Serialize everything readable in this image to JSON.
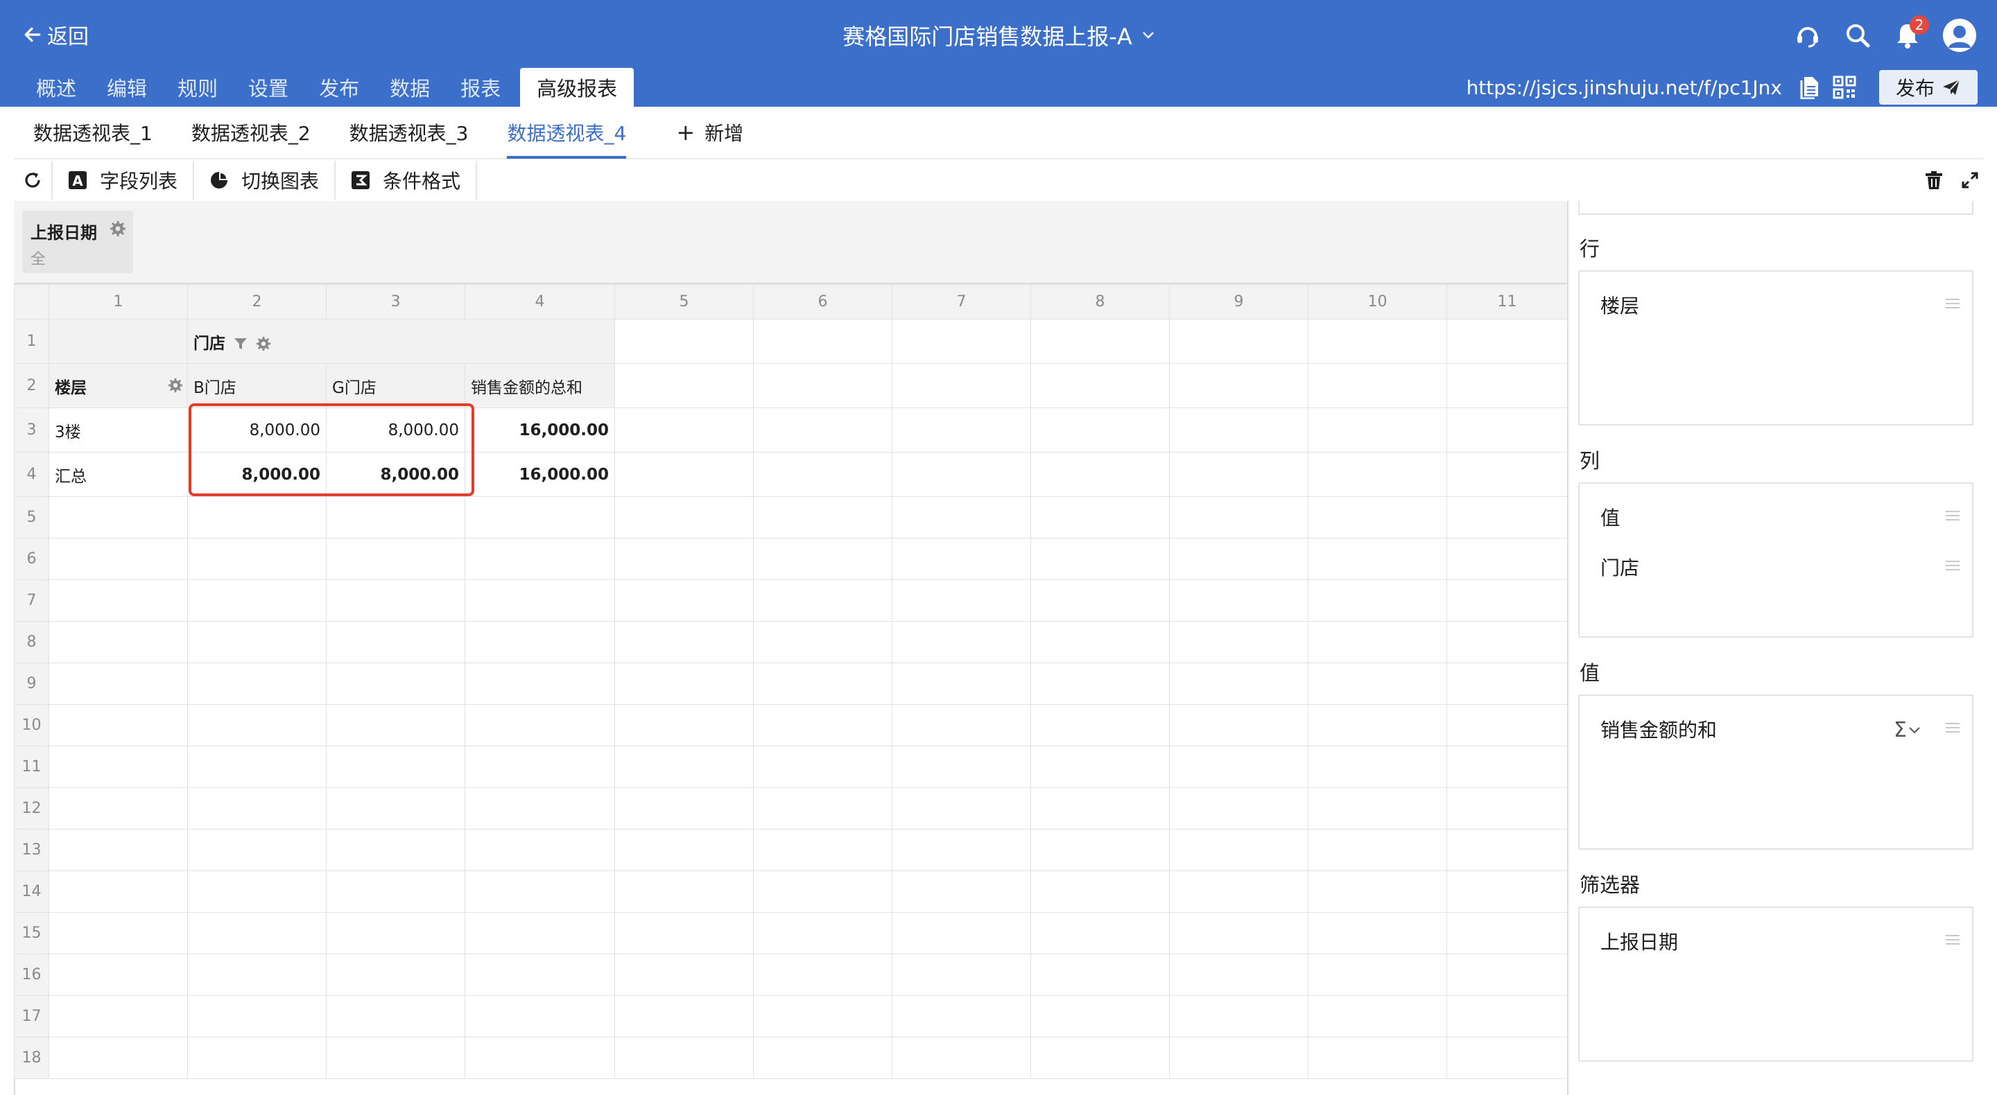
{
  "header": {
    "back_label": "返回",
    "form_title": "赛格国际门店销售数据上报-A",
    "notification_count": "2",
    "url": "https://jsjcs.jinshuju.net/f/pc1Jnx",
    "publish_label": "发布",
    "nav_tabs": [
      "概述",
      "编辑",
      "规则",
      "设置",
      "发布",
      "数据",
      "报表",
      "高级报表"
    ],
    "active_nav": "高级报表",
    "brand_color": "#3b6fc9"
  },
  "sheet_tabs": [
    "数据透视表_1",
    "数据透视表_2",
    "数据透视表_3",
    "数据透视表_4"
  ],
  "active_sheet": "数据透视表_4",
  "add_tab_label": "新增",
  "toolbar": {
    "field_list": "字段列表",
    "switch_chart": "切换图表",
    "conditional_format": "条件格式"
  },
  "filter": {
    "title": "上报日期",
    "value": "全"
  },
  "grid": {
    "columns": [
      "1",
      "2",
      "3",
      "4",
      "5",
      "6",
      "7",
      "8",
      "9",
      "10",
      "11"
    ],
    "row_numbers": [
      "1",
      "2",
      "3",
      "4",
      "5",
      "6",
      "7",
      "8",
      "9",
      "10",
      "11",
      "12",
      "13",
      "14",
      "15",
      "16",
      "17",
      "18"
    ],
    "column_field": "门店",
    "row_field": "楼层",
    "headers": [
      "B门店",
      "G门店",
      "销售金额的总和"
    ],
    "rows": [
      {
        "label": "3楼",
        "values": [
          "8,000.00",
          "8,000.00",
          "16,000.00"
        ]
      },
      {
        "label": "汇总",
        "values": [
          "8,000.00",
          "8,000.00",
          "16,000.00"
        ]
      }
    ]
  },
  "panel": {
    "rows_label": "行",
    "rows_items": [
      "楼层"
    ],
    "columns_label": "列",
    "columns_items": [
      "值",
      "门店"
    ],
    "values_label": "值",
    "values_items": [
      "销售金额的和"
    ],
    "filters_label": "筛选器",
    "filters_items": [
      "上报日期"
    ]
  },
  "highlight_color": "#e23c2b"
}
